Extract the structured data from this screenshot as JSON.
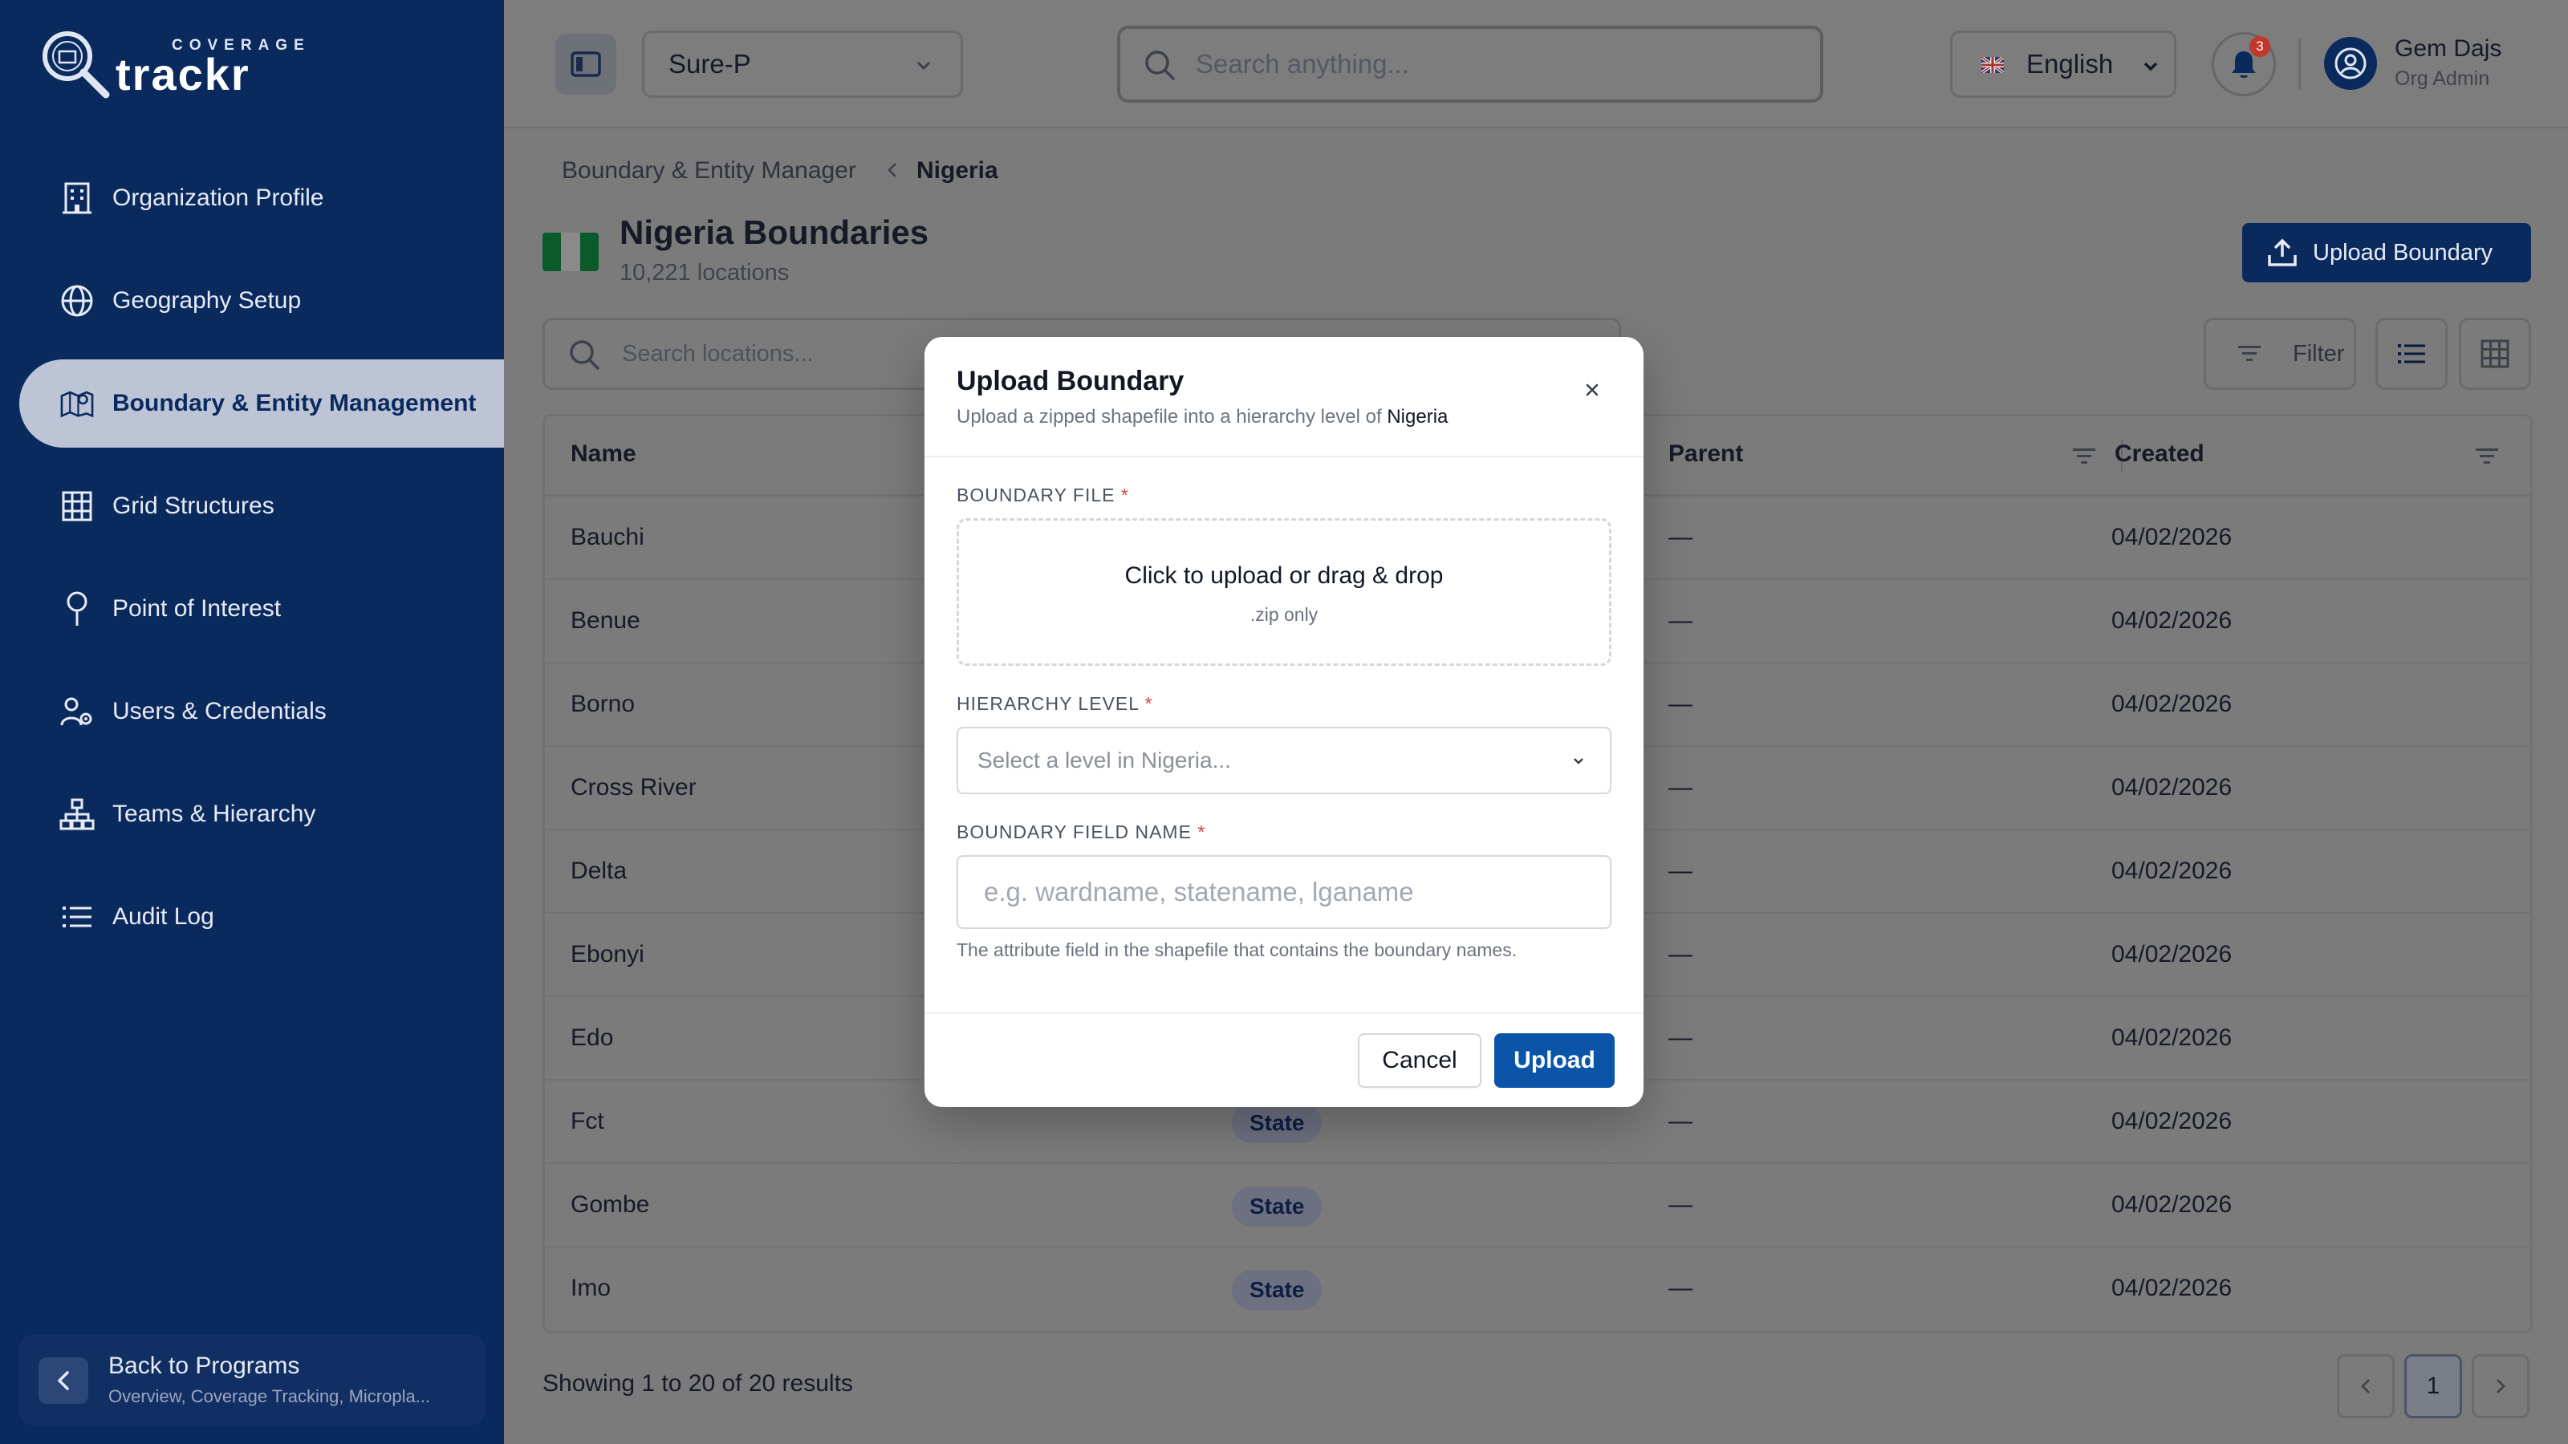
{
  "brand": {
    "top": "COVERAGE",
    "word": "trackr"
  },
  "sidebar": {
    "items": [
      {
        "label": "Organization Profile",
        "icon": "building-icon"
      },
      {
        "label": "Geography Setup",
        "icon": "globe-icon"
      },
      {
        "label": "Boundary & Entity Management",
        "icon": "map-pin-icon",
        "active": true
      },
      {
        "label": "Grid Structures",
        "icon": "grid-icon"
      },
      {
        "label": "Point of Interest",
        "icon": "pin-icon"
      },
      {
        "label": "Users & Credentials",
        "icon": "users-gear-icon"
      },
      {
        "label": "Teams & Hierarchy",
        "icon": "hierarchy-icon"
      },
      {
        "label": "Audit Log",
        "icon": "list-icon"
      }
    ],
    "back": {
      "title": "Back to Programs",
      "subtitle": "Overview, Coverage Tracking, Micropla..."
    }
  },
  "topbar": {
    "program": "Sure-P",
    "search_placeholder": "Search anything...",
    "language": "English",
    "notifications": "3",
    "user_name": "Gem Dajs",
    "user_role": "Org Admin"
  },
  "breadcrumb": {
    "parent": "Boundary & Entity Manager",
    "current": "Nigeria"
  },
  "page": {
    "title": "Nigeria Boundaries",
    "count": "10,221 locations",
    "upload_label": "Upload Boundary",
    "search_placeholder": "Search locations...",
    "filter_label": "Filter"
  },
  "table": {
    "headers": {
      "name": "Name",
      "parent": "Parent",
      "created": "Created"
    },
    "rows": [
      {
        "name": "Bauchi",
        "level": "",
        "parent": "—",
        "created": "04/02/2026"
      },
      {
        "name": "Benue",
        "level": "",
        "parent": "—",
        "created": "04/02/2026"
      },
      {
        "name": "Borno",
        "level": "",
        "parent": "—",
        "created": "04/02/2026"
      },
      {
        "name": "Cross River",
        "level": "",
        "parent": "—",
        "created": "04/02/2026"
      },
      {
        "name": "Delta",
        "level": "",
        "parent": "—",
        "created": "04/02/2026"
      },
      {
        "name": "Ebonyi",
        "level": "",
        "parent": "—",
        "created": "04/02/2026"
      },
      {
        "name": "Edo",
        "level": "",
        "parent": "—",
        "created": "04/02/2026"
      },
      {
        "name": "Fct",
        "level": "State",
        "parent": "—",
        "created": "04/02/2026"
      },
      {
        "name": "Gombe",
        "level": "State",
        "parent": "—",
        "created": "04/02/2026"
      },
      {
        "name": "Imo",
        "level": "State",
        "parent": "—",
        "created": "04/02/2026"
      }
    ]
  },
  "pagination": {
    "showing": "Showing 1 to 20 of 20 results",
    "page": "1"
  },
  "modal": {
    "title": "Upload Boundary",
    "subtitle_prefix": "Upload a zipped shapefile into a hierarchy level of ",
    "subtitle_country": "Nigeria",
    "file_label": "BOUNDARY FILE",
    "dropzone_text": "Click to upload or drag & drop",
    "dropzone_hint": ".zip only",
    "level_label": "HIERARCHY LEVEL",
    "level_placeholder": "Select a level in Nigeria...",
    "field_label": "BOUNDARY FIELD NAME",
    "field_placeholder": "e.g. wardname, statename, lganame",
    "field_help": "The attribute field in the shapefile that contains the boundary names.",
    "required_mark": "*",
    "cancel_label": "Cancel",
    "upload_label": "Upload"
  },
  "colors": {
    "sidebar": "#0a2a5e",
    "primary": "#0b55a8",
    "required": "#d1453b"
  }
}
